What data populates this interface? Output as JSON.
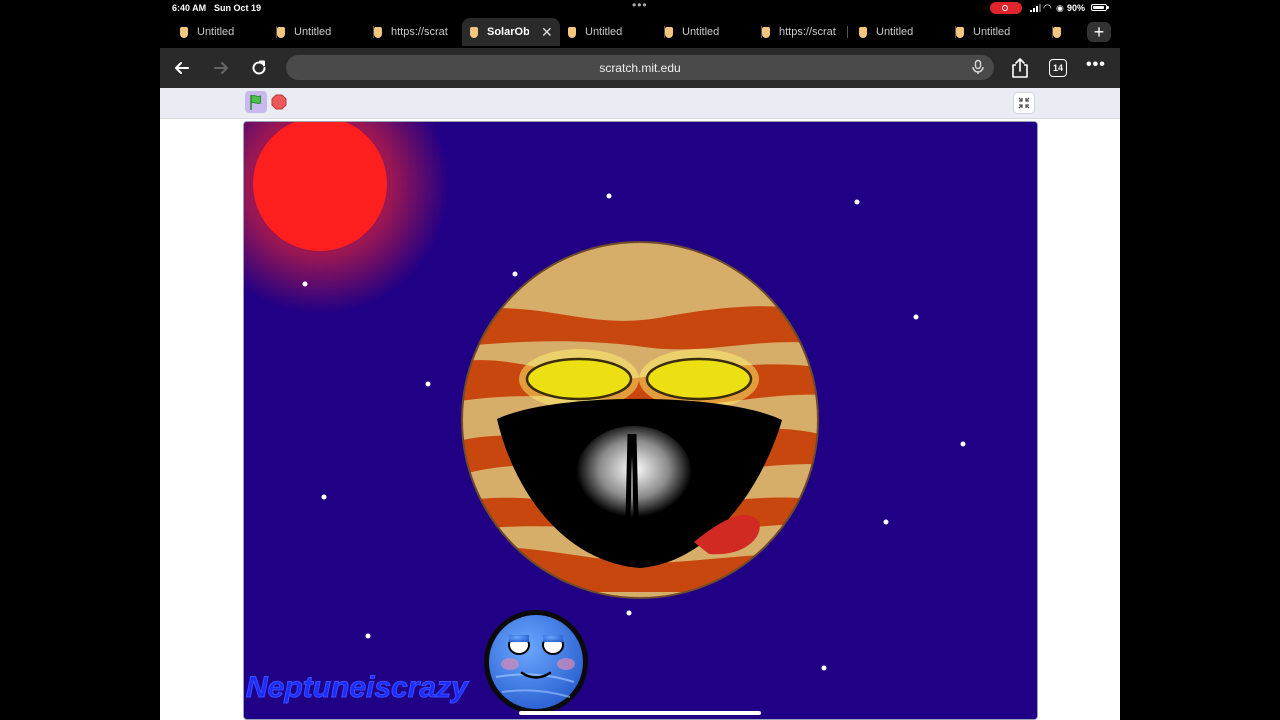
{
  "status_bar": {
    "time": "6:40 AM",
    "date": "Sun Oct 19",
    "battery": "90%"
  },
  "tabs": [
    {
      "label": "Untitled"
    },
    {
      "label": "Untitled"
    },
    {
      "label": "https://scrat"
    },
    {
      "label": "SolarObj",
      "active": true
    },
    {
      "label": "Untitled"
    },
    {
      "label": "Untitled"
    },
    {
      "label": "https://scrat"
    },
    {
      "label": "Untitled"
    },
    {
      "label": "Untitled"
    }
  ],
  "toolbar": {
    "url": "scratch.mit.edu",
    "tab_count": "14"
  },
  "stage": {
    "watermark": "Neptuneiscrazy",
    "colors": {
      "sky": "#200085",
      "sun": "#ff1f1f",
      "planet": "#d7ad6a",
      "bands": "#c8470f",
      "eyes": "#ecdf12",
      "neptune": "#3a7be8"
    }
  },
  "icons": [
    "green-flag-icon",
    "stop-icon",
    "fullscreen-exit-icon",
    "share-icon",
    "mic-icon",
    "back-arrow-icon",
    "forward-arrow-icon",
    "reload-icon"
  ]
}
